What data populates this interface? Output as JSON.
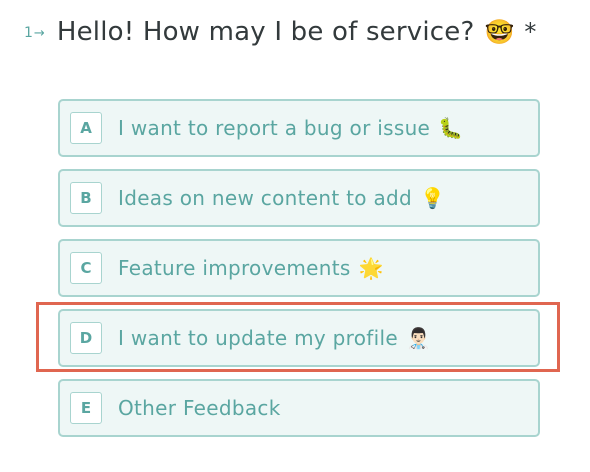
{
  "question": {
    "number": "1",
    "arrow": "→",
    "text": "Hello! How may I be of service?",
    "emoji": "🤓",
    "required_marker": "*"
  },
  "choices": [
    {
      "key": "A",
      "label": "I want to report a bug or issue",
      "emoji": "🐛"
    },
    {
      "key": "B",
      "label": "Ideas on new content to add",
      "emoji": "💡"
    },
    {
      "key": "C",
      "label": "Feature improvements",
      "emoji": "🌟"
    },
    {
      "key": "D",
      "label": "I want to update my profile",
      "emoji": "👨🏻‍⚕️"
    },
    {
      "key": "E",
      "label": "Other Feedback",
      "emoji": ""
    }
  ],
  "highlighted_choice": "D",
  "colors": {
    "accent": "#5aa6a1",
    "choice_border": "#a8d4cf",
    "choice_background": "#eef7f6",
    "question_text": "#333a3c",
    "highlight": "#e06650"
  }
}
